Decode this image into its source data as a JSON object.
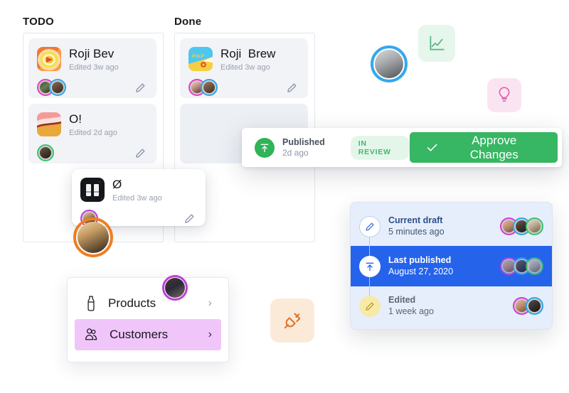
{
  "board": {
    "columns": [
      {
        "name": "todo",
        "title": "TODO",
        "cards": [
          {
            "title": "Roji Bev",
            "subtitle": "Edited 3w ago",
            "thumb": "roji-bev-thumbnail",
            "edit_icon": "pencil-icon",
            "collaborators": [
              "avatar-pink",
              "avatar-blue"
            ]
          },
          {
            "title": "O!",
            "subtitle": "Edited 2d ago",
            "thumb": "o-thumbnail",
            "edit_icon": "pencil-icon",
            "collaborators": [
              "avatar-green"
            ]
          }
        ]
      },
      {
        "name": "done",
        "title": "Done",
        "cards": [
          {
            "title": "Roji  Brew",
            "subtitle": "Edited 3w ago",
            "thumb": "pulp-thumbnail",
            "thumb_label": "PULP",
            "edit_icon": "pencil-icon",
            "collaborators": [
              "avatar-pink",
              "avatar-blue"
            ]
          }
        ],
        "placeholder": "drop-zone"
      }
    ]
  },
  "dragging_card": {
    "title": "Ø",
    "subtitle": "Edited 3w ago",
    "thumb": "dark-thumbnail",
    "edit_icon": "pencil-icon",
    "collaborators": [
      "avatar-purple"
    ]
  },
  "publish_bar": {
    "status_icon": "publish-upload-icon",
    "status_title": "Published",
    "status_time": "2d ago",
    "badge": "IN REVIEW",
    "approve_label": "Approve Changes",
    "approve_icon": "check-icon",
    "accent_green": "#37b663",
    "badge_bg": "#e4f6ea",
    "badge_fg": "#43b96b"
  },
  "version_history": {
    "selected_index": 1,
    "panel_bg": "#e6eefc",
    "selected_bg": "#2563eb",
    "rows": [
      {
        "icon": "pencil-icon",
        "title": "Current draft",
        "time": "5 minutes ago",
        "avatars": [
          "avatar-magenta",
          "avatar-blue",
          "avatar-green"
        ]
      },
      {
        "icon": "publish-upload-icon",
        "title": "Last published",
        "time": "August 27, 2020",
        "avatars": [
          "avatar-magenta",
          "avatar-blue",
          "avatar-green"
        ]
      },
      {
        "icon": "pencil-icon",
        "title": "Edited",
        "time": "1 week ago",
        "avatars": [
          "avatar-magenta",
          "avatar-blue"
        ]
      }
    ]
  },
  "nav_menu": {
    "items": [
      {
        "icon": "bottle-icon",
        "label": "Products",
        "chevron": "›",
        "active": false
      },
      {
        "icon": "customers-icon",
        "label": "Customers",
        "chevron": "›",
        "active": true
      }
    ],
    "active_bg": "#f0c6fa"
  },
  "floating": {
    "chart_tile": {
      "icon": "line-chart-icon",
      "bg": "#e6f6ec",
      "fg": "#5cb887"
    },
    "bulb_tile": {
      "icon": "lightbulb-icon",
      "bg": "#fbe4f2",
      "fg": "#e060a8"
    },
    "plug_tile": {
      "icon": "plug-icon",
      "bg": "#fcead9",
      "fg": "#e0722a"
    },
    "cursor_avatar": {
      "name": "avatar-blue-ring",
      "ring": "#35a7ef"
    },
    "corner_avatar": {
      "name": "avatar-orange-ring",
      "ring": "#ef7d23"
    },
    "menu_avatar": {
      "name": "avatar-purple-ring",
      "ring": "#c13ddb"
    }
  }
}
